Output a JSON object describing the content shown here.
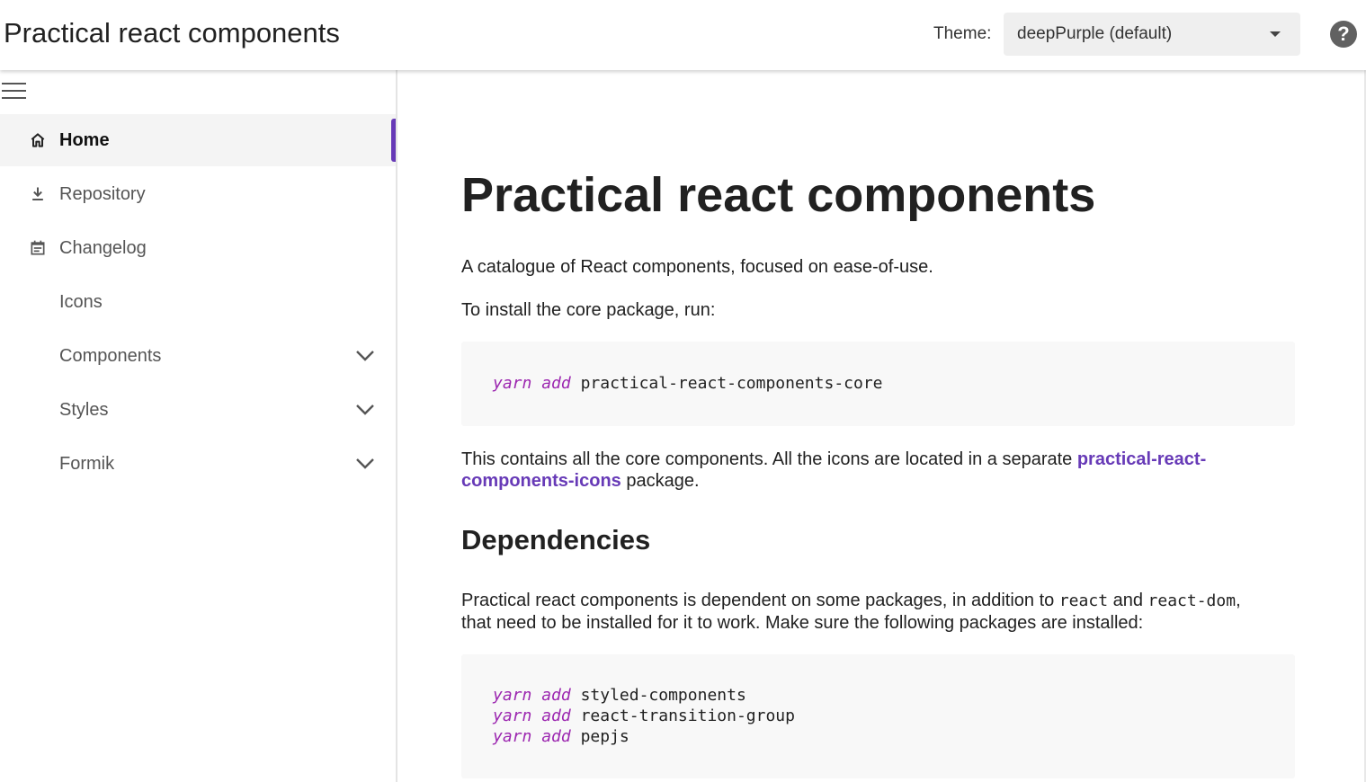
{
  "header": {
    "title": "Practical react components",
    "theme_label": "Theme:",
    "theme_value": "deepPurple (default)",
    "help_icon": "help-circle-icon"
  },
  "sidebar": {
    "menu_icon": "hamburger-menu-icon",
    "items": [
      {
        "label": "Home",
        "icon": "home-icon",
        "active": true
      },
      {
        "label": "Repository",
        "icon": "download-icon"
      },
      {
        "label": "Changelog",
        "icon": "calendar-icon"
      },
      {
        "label": "Icons"
      },
      {
        "label": "Components",
        "expandable": true
      },
      {
        "label": "Styles",
        "expandable": true
      },
      {
        "label": "Formik",
        "expandable": true
      }
    ]
  },
  "main": {
    "heading": "Practical react components",
    "intro": "A catalogue of React components, focused on ease-of-use.",
    "install_intro": "To install the core package, run:",
    "install_cmd": {
      "kw1": "yarn",
      "kw2": "add",
      "pkg": "practical-react-components-core"
    },
    "core_text_before": "This contains all the core components. All the icons are located in a separate ",
    "icons_link": "practical-react-components-icons",
    "core_text_after": " package.",
    "deps_heading": "Dependencies",
    "deps_text_1": "Practical react components is dependent on some packages, in addition to ",
    "deps_code_react": "react",
    "deps_text_and": " and ",
    "deps_code_react_dom": "react-dom",
    "deps_text_2": ",",
    "deps_text_3": "that need to be installed for it to work. Make sure the following packages are installed:",
    "deps_cmds": [
      {
        "kw1": "yarn",
        "kw2": "add",
        "pkg": "styled-components"
      },
      {
        "kw1": "yarn",
        "kw2": "add",
        "pkg": "react-transition-group"
      },
      {
        "kw1": "yarn",
        "kw2": "add",
        "pkg": "pepjs"
      }
    ]
  },
  "colors": {
    "accent": "#673ab7",
    "code_keyword": "#9c27b0",
    "code_bg": "#f8f8f8"
  }
}
